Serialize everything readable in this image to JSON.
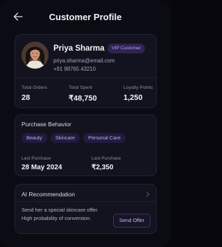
{
  "header": {
    "title": "Customer Profile",
    "back_icon": "arrow-left-icon"
  },
  "profile": {
    "name": "Priya Sharma",
    "badge": "VIP Customer",
    "email": "priya.sharma@email.com",
    "phone": "+91 98765 43210",
    "stats": {
      "orders_label": "Total Orders",
      "orders_value": "28",
      "spent_label": "Total Spent",
      "spent_value": "₹48,750",
      "points_label": "Loyalty Points",
      "points_value": "1,250"
    }
  },
  "behavior": {
    "title": "Purchase Behavior",
    "tags": [
      "Beauty",
      "Skincare",
      "Personal Care"
    ],
    "last_purchase_label": "Last Purchase",
    "last_purchase_value": "28 May 2024",
    "last_amount_label": "Last Purchase",
    "last_amount_value": "₹2,350"
  },
  "ai": {
    "title": "AI Recommendation",
    "line1": "Send her a special skincare offer.",
    "line2": "High probability of conversion.",
    "button_label": "Send Offer",
    "chevron_icon": "chevron-right-icon"
  },
  "colors": {
    "background": "#0b0b13",
    "card": "#13131f",
    "accent": "#b3a3f0",
    "badge_bg": "#2e2452"
  }
}
